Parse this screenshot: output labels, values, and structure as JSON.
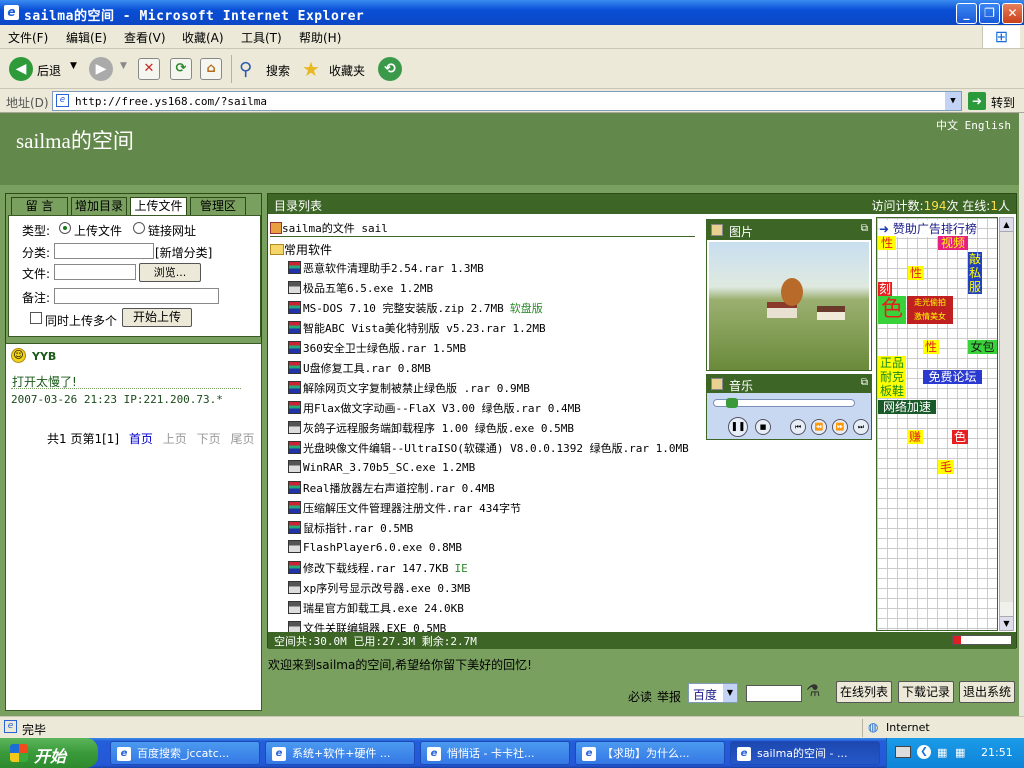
{
  "window": {
    "title": "sailma的空间 - Microsoft Internet Explorer"
  },
  "menu": [
    "文件(F)",
    "编辑(E)",
    "查看(V)",
    "收藏(A)",
    "工具(T)",
    "帮助(H)"
  ],
  "toolbar": {
    "back": "后退",
    "search": "搜索",
    "favorites": "收藏夹"
  },
  "address": {
    "label": "地址(D)",
    "url": "http://free.ys168.com/?sailma",
    "go": "转到"
  },
  "header": {
    "title": "sailma的空间",
    "lang": "中文 English"
  },
  "tabs": [
    "留 言",
    "增加目录",
    "上传文件",
    "管理区"
  ],
  "upload": {
    "type_label": "类型:",
    "opt_upload": "上传文件",
    "opt_link": "链接网址",
    "category_label": "分类:",
    "new_category": "[新增分类]",
    "file_label": "文件:",
    "browse": "浏览...",
    "note_label": "备注:",
    "multi": "同时上传多个",
    "start": "开始上传"
  },
  "message": {
    "user": "YYB",
    "text": "打开太慢了!",
    "meta": "2007-03-26 21:23 IP:221.200.73.*",
    "pager": {
      "summary": "共1 页第1[1]",
      "first": "首页",
      "prev": "上页",
      "next": "下页",
      "last": "尾页"
    }
  },
  "dir": {
    "title": "目录列表",
    "counter_label": "访问计数:",
    "counter_value": "194",
    "counter_unit": "次 在线:",
    "online": "1",
    "online_unit": "人",
    "root": "sailma的文件 sail",
    "folder": "常用软件",
    "files": [
      {
        "name": "恶意软件清理助手2.54.rar 1.3MB",
        "icon": "rar"
      },
      {
        "name": "极品五笔6.5.exe 1.2MB",
        "icon": "disk"
      },
      {
        "name": "MS-DOS 7.10 完整安装版.zip 2.7MB",
        "note": "软盘版",
        "icon": "rar"
      },
      {
        "name": "智能ABC Vista美化特别版 v5.23.rar 1.2MB",
        "icon": "rar"
      },
      {
        "name": "360安全卫士绿色版.rar 1.5MB",
        "icon": "rar"
      },
      {
        "name": "U盘修复工具.rar 0.8MB",
        "icon": "rar"
      },
      {
        "name": "解除网页文字复制被禁止绿色版 .rar 0.9MB",
        "icon": "rar"
      },
      {
        "name": "用Flax做文字动画--FlaX V3.00 绿色版.rar 0.4MB",
        "icon": "rar"
      },
      {
        "name": "灰鸽子远程服务端卸载程序 1.00 绿色版.exe 0.5MB",
        "icon": "disk"
      },
      {
        "name": "光盘映像文件编辑--UltraISO(软碟通) V8.0.0.1392 绿色版.rar 1.0MB",
        "icon": "rar"
      },
      {
        "name": "WinRAR_3.70b5_SC.exe 1.2MB",
        "icon": "disk"
      },
      {
        "name": "Real播放器左右声道控制.rar 0.4MB",
        "icon": "rar"
      },
      {
        "name": "压缩解压文件管理器注册文件.rar 434字节",
        "icon": "rar"
      },
      {
        "name": "鼠标指针.rar 0.5MB",
        "icon": "rar"
      },
      {
        "name": "FlashPlayer6.0.exe 0.8MB",
        "icon": "disk"
      },
      {
        "name": "修改下载线程.rar 147.7KB",
        "note": "IE",
        "icon": "rar"
      },
      {
        "name": "xp序列号显示改号器.exe 0.3MB",
        "icon": "disk"
      },
      {
        "name": "瑞星官方卸载工具.exe 24.0KB",
        "icon": "disk"
      },
      {
        "name": "文件关联编辑器.EXE 0.5MB",
        "icon": "disk"
      }
    ],
    "space": "空间共:30.0M 已用:27.3M 剩余:2.7M",
    "space_used_fraction": 0.91
  },
  "widgets": {
    "picture": "图片",
    "music": "音乐"
  },
  "ads": {
    "title": "赞助广告排行榜",
    "items": [
      "性",
      "视频",
      "敲",
      "私",
      "服",
      "性",
      "刻",
      "色",
      "走光偷拍",
      "激情美女",
      "性",
      "女包",
      "正品",
      "耐克",
      "板鞋",
      "免费论坛",
      "网络加速",
      "赚",
      "色",
      "毛"
    ]
  },
  "footer": {
    "welcome": "欢迎来到sailma的空间,希望给你留下美好的回忆!",
    "must_read": "必读",
    "report": "举报",
    "engine": "百度",
    "btn_online": "在线列表",
    "btn_log": "下载记录",
    "btn_exit": "退出系统"
  },
  "status": {
    "left": "完毕",
    "zone": "Internet"
  },
  "taskbar": {
    "start": "开始",
    "tasks": [
      "百度搜索_jccatc...",
      "系统+软件+硬件 ...",
      "悄悄话 - 卡卡社...",
      "【求助】为什么...",
      "sailma的空间 - ..."
    ],
    "clock": "21:51"
  },
  "colors": {
    "header": "#63884b",
    "body": "#7aa060",
    "panel_head": "#3d6626",
    "xp_blue": "#0a4fd6"
  }
}
